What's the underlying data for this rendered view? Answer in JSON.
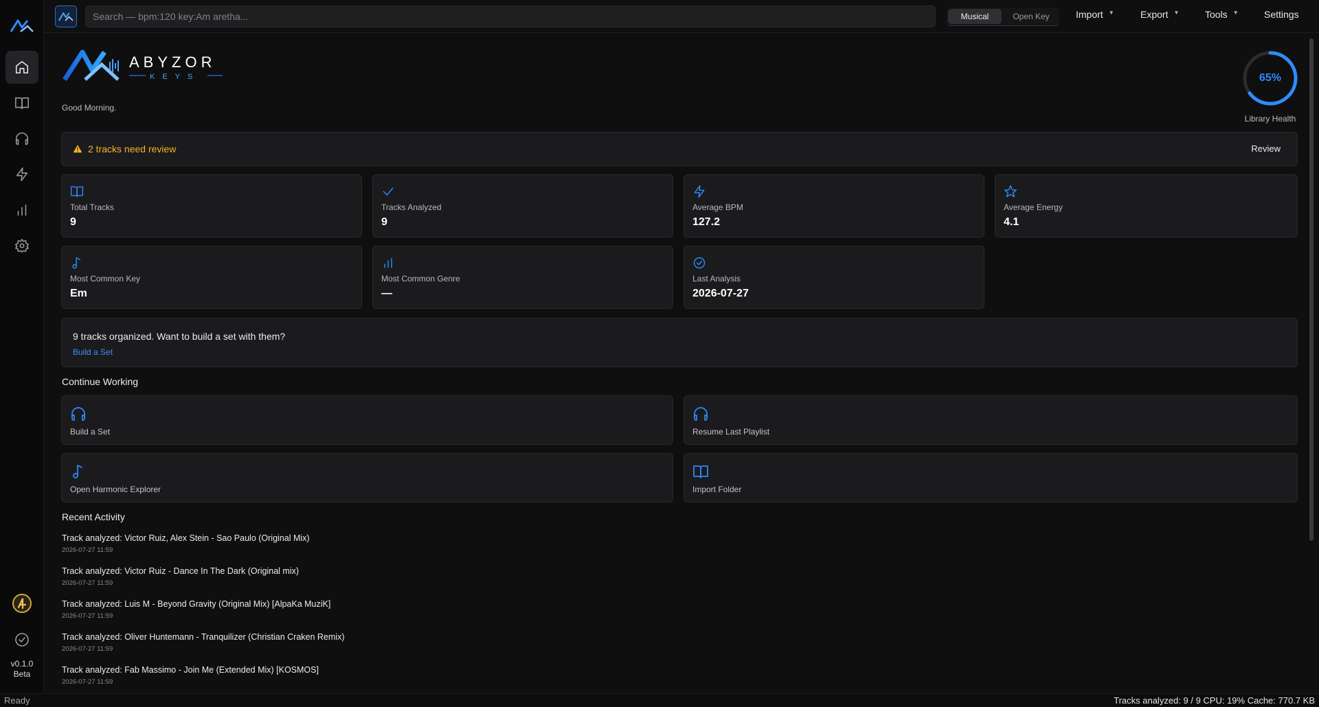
{
  "topbar": {
    "search_placeholder": "Search — bpm:120 key:Am aretha...",
    "key_mode": {
      "options": [
        "Musical",
        "Open Key"
      ],
      "selected": "Musical"
    },
    "menus": [
      "Import",
      "Export",
      "Tools",
      "Settings"
    ]
  },
  "rail": {
    "items": [
      "home-icon",
      "library-icon",
      "headphones-icon",
      "energy-icon",
      "stats-icon",
      "settings-icon"
    ],
    "active": "home-icon",
    "version": "v0.1.0",
    "channel": "Beta"
  },
  "brand": {
    "name": "ABYZOR",
    "sub": "KEYS"
  },
  "greeting": "Good Morning.",
  "health": {
    "value_text": "65%",
    "fraction": 0.65,
    "label": "Library Health"
  },
  "alert": {
    "message": "2 tracks need review",
    "action": "Review",
    "color": "#f5b323"
  },
  "stats": [
    {
      "icon": "book-icon",
      "label": "Total Tracks",
      "value": "9"
    },
    {
      "icon": "check-icon",
      "label": "Tracks Analyzed",
      "value": "9"
    },
    {
      "icon": "bolt-icon",
      "label": "Average BPM",
      "value": "127.2"
    },
    {
      "icon": "star-icon",
      "label": "Average Energy",
      "value": "4.1"
    },
    {
      "icon": "music-note-icon",
      "label": "Most Common Key",
      "value": "Em"
    },
    {
      "icon": "bar-chart-icon",
      "label": "Most Common Genre",
      "value": "—"
    },
    {
      "icon": "check-circle-icon",
      "label": "Last Analysis",
      "value": "2026-07-27"
    }
  ],
  "promo": {
    "question": "9 tracks organized. Want to build a set with them?",
    "link": "Build a Set"
  },
  "continue": {
    "title": "Continue Working",
    "actions": [
      {
        "icon": "headphones-icon",
        "label": "Build a Set"
      },
      {
        "icon": "headphones-icon",
        "label": "Resume Last Playlist"
      },
      {
        "icon": "music-note-icon",
        "label": "Open Harmonic Explorer"
      },
      {
        "icon": "book-icon",
        "label": "Import Folder"
      }
    ]
  },
  "recent": {
    "title": "Recent Activity",
    "items": [
      {
        "text": "Track analyzed: Victor Ruiz, Alex Stein - Sao Paulo (Original Mix)",
        "time": "2026-07-27 11:59"
      },
      {
        "text": "Track analyzed: Victor Ruiz - Dance In The Dark (Original mix)",
        "time": "2026-07-27 11:59"
      },
      {
        "text": "Track analyzed: Luis M - Beyond Gravity (Original Mix) [AlpaKa MuziK]",
        "time": "2026-07-27 11:59"
      },
      {
        "text": "Track analyzed: Oliver Huntemann - Tranquilizer (Christian Craken Remix)",
        "time": "2026-07-27 11:59"
      },
      {
        "text": "Track analyzed: Fab Massimo - Join Me (Extended Mix) [KOSMOS]",
        "time": "2026-07-27 11:59"
      }
    ]
  },
  "status": {
    "left": "Ready",
    "right": "Tracks analyzed: 9 / 9  CPU: 19%  Cache: 770.7 KB"
  },
  "colors": {
    "accent": "#2d8cff",
    "warning": "#f5b323",
    "background": "#0f0f10",
    "card": "#1b1b1e"
  }
}
